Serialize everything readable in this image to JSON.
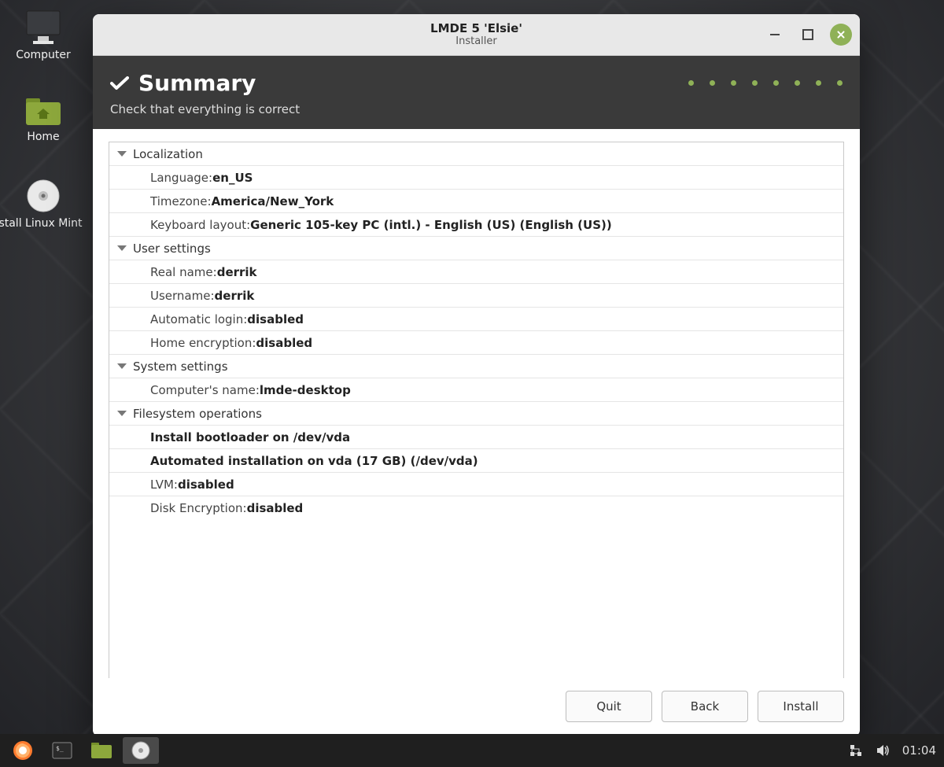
{
  "desktop": {
    "icons": [
      {
        "name": "computer-icon",
        "label": "Computer"
      },
      {
        "name": "home-icon",
        "label": "Home"
      },
      {
        "name": "install-icon",
        "label": "Install Linux Mint"
      }
    ]
  },
  "window": {
    "title": "LMDE 5 'Elsie'",
    "subtitle": "Installer",
    "header_title": "Summary",
    "header_subtitle": "Check that everything is correct",
    "step_dots": 8,
    "buttons": {
      "quit": "Quit",
      "back": "Back",
      "install": "Install"
    }
  },
  "summary": {
    "groups": [
      {
        "name": "localization",
        "label": "Localization",
        "items": [
          {
            "label": "Language: ",
            "value": "en_US"
          },
          {
            "label": "Timezone: ",
            "value": "America/New_York"
          },
          {
            "label": "Keyboard layout: ",
            "value": "Generic 105-key PC (intl.) - English (US) (English (US))"
          }
        ]
      },
      {
        "name": "user-settings",
        "label": "User settings",
        "items": [
          {
            "label": "Real name: ",
            "value": "derrik"
          },
          {
            "label": "Username: ",
            "value": "derrik"
          },
          {
            "label": "Automatic login: ",
            "value": "disabled"
          },
          {
            "label": "Home encryption: ",
            "value": "disabled"
          }
        ]
      },
      {
        "name": "system-settings",
        "label": "System settings",
        "items": [
          {
            "label": "Computer's name: ",
            "value": "lmde-desktop"
          }
        ]
      },
      {
        "name": "filesystem-operations",
        "label": "Filesystem operations",
        "items": [
          {
            "bold_line": "Install bootloader on /dev/vda"
          },
          {
            "bold_line": "Automated installation on vda (17 GB) (/dev/vda)"
          },
          {
            "label": "LVM: ",
            "value": "disabled"
          },
          {
            "label": "Disk Encryption: ",
            "value": "disabled"
          }
        ]
      }
    ]
  },
  "panel": {
    "clock": "01:04"
  },
  "colors": {
    "accent": "#8fb157"
  }
}
